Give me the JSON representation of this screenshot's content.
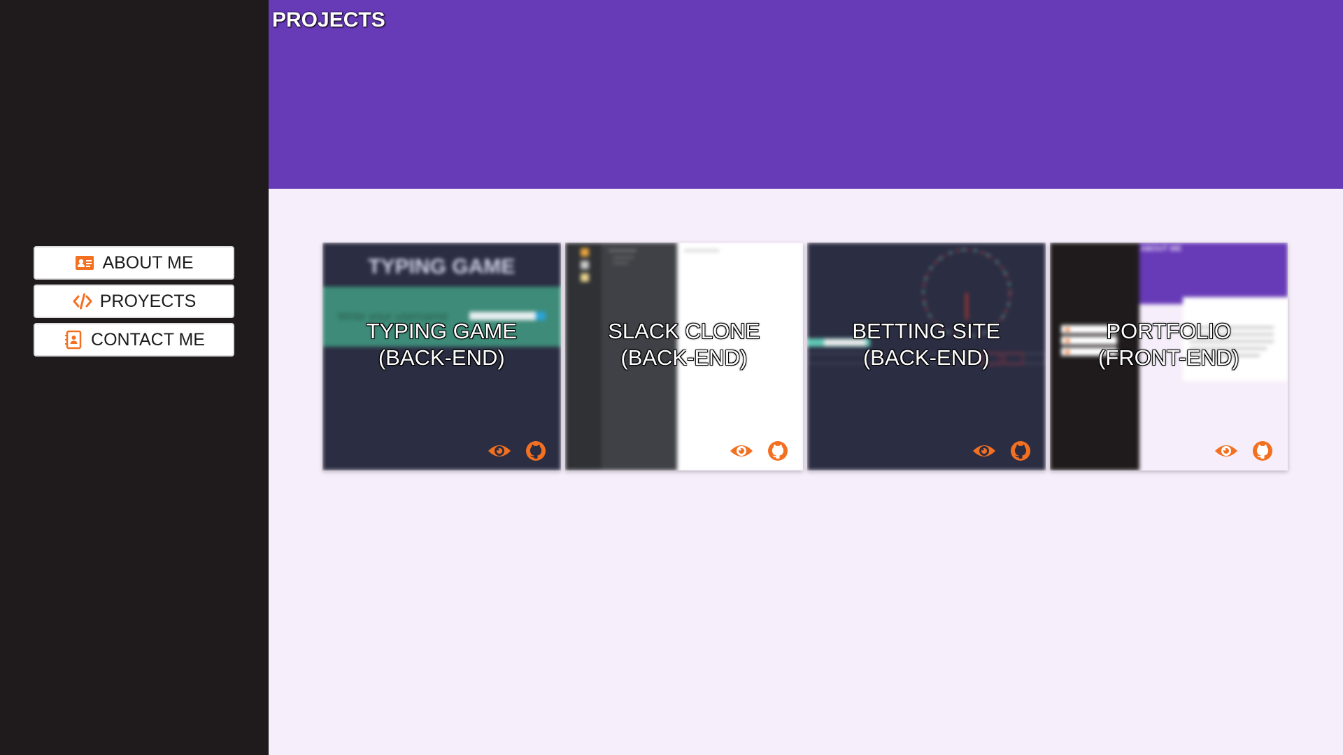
{
  "colors": {
    "sidebar_bg": "#1f1b1c",
    "header_bg": "#673ab7",
    "content_bg": "#f6eefa",
    "accent": "#f37021"
  },
  "sidebar": {
    "items": [
      {
        "label": "ABOUT ME",
        "icon": "id-card-icon"
      },
      {
        "label": "PROYECTS",
        "icon": "code-icon"
      },
      {
        "label": "CONTACT ME",
        "icon": "contact-book-icon"
      }
    ]
  },
  "header": {
    "title": "PROJECTS"
  },
  "projects": [
    {
      "title": "TYPING GAME",
      "subtitle": "(BACK-END)",
      "thumb_heading": "TYPING GAME",
      "thumb_prompt": "Write your username",
      "icons": [
        "eye-icon",
        "github-icon"
      ]
    },
    {
      "title": "SLACK CLONE",
      "subtitle": "(BACK-END)",
      "icons": [
        "eye-icon",
        "github-icon"
      ]
    },
    {
      "title": "BETTING SITE",
      "subtitle": "(BACK-END)",
      "icons": [
        "eye-icon",
        "github-icon"
      ]
    },
    {
      "title": "PORTFOLIO",
      "subtitle": "(FRONT-END)",
      "thumb_heading": "ABOUT ME",
      "icons": [
        "eye-icon",
        "github-icon"
      ]
    }
  ]
}
